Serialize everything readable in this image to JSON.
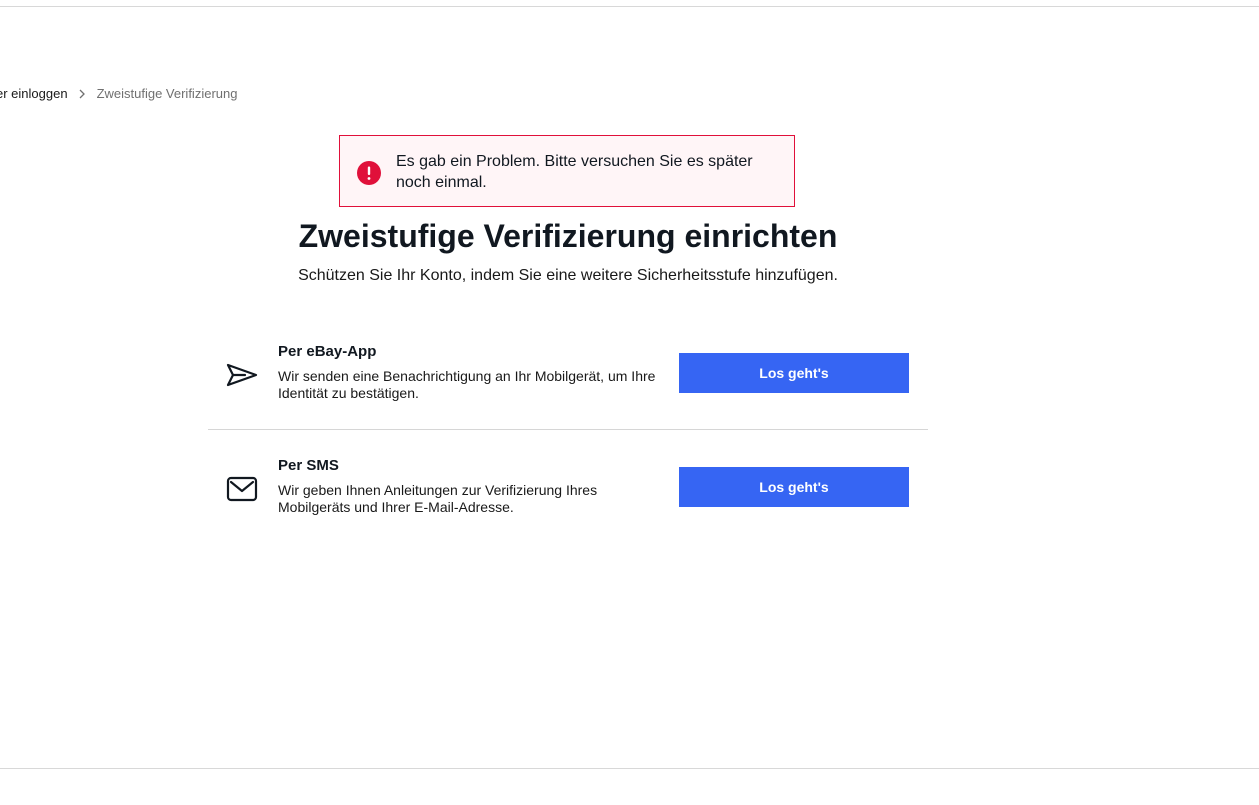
{
  "breadcrumb": {
    "items": [
      {
        "label": "er einloggen"
      },
      {
        "label": "Zweistufige Verifizierung"
      }
    ]
  },
  "alert": {
    "message": "Es gab ein Problem. Bitte versuchen Sie es später noch einmal.",
    "icon": "error-exclamation-icon",
    "color": "#e0103a"
  },
  "header": {
    "title": "Zweistufige Verifizierung einrichten",
    "subtitle": "Schützen Sie Ihr Konto, indem Sie eine weitere Sicherheitsstufe hinzufügen."
  },
  "options": [
    {
      "icon": "paper-plane-icon",
      "title": "Per eBay-App",
      "description": "Wir senden eine Benachrichtigung an Ihr Mobilgerät, um Ihre Identität zu bestätigen.",
      "button_label": "Los geht's"
    },
    {
      "icon": "envelope-icon",
      "title": "Per SMS",
      "description": "Wir geben Ihnen Anleitungen zur Verifizierung Ihres Mobilgeräts und Ihrer E-Mail-Adresse.",
      "button_label": "Los geht's"
    }
  ],
  "colors": {
    "accent": "#3665f3",
    "error": "#e0103a",
    "error_background": "#fff5f7"
  }
}
